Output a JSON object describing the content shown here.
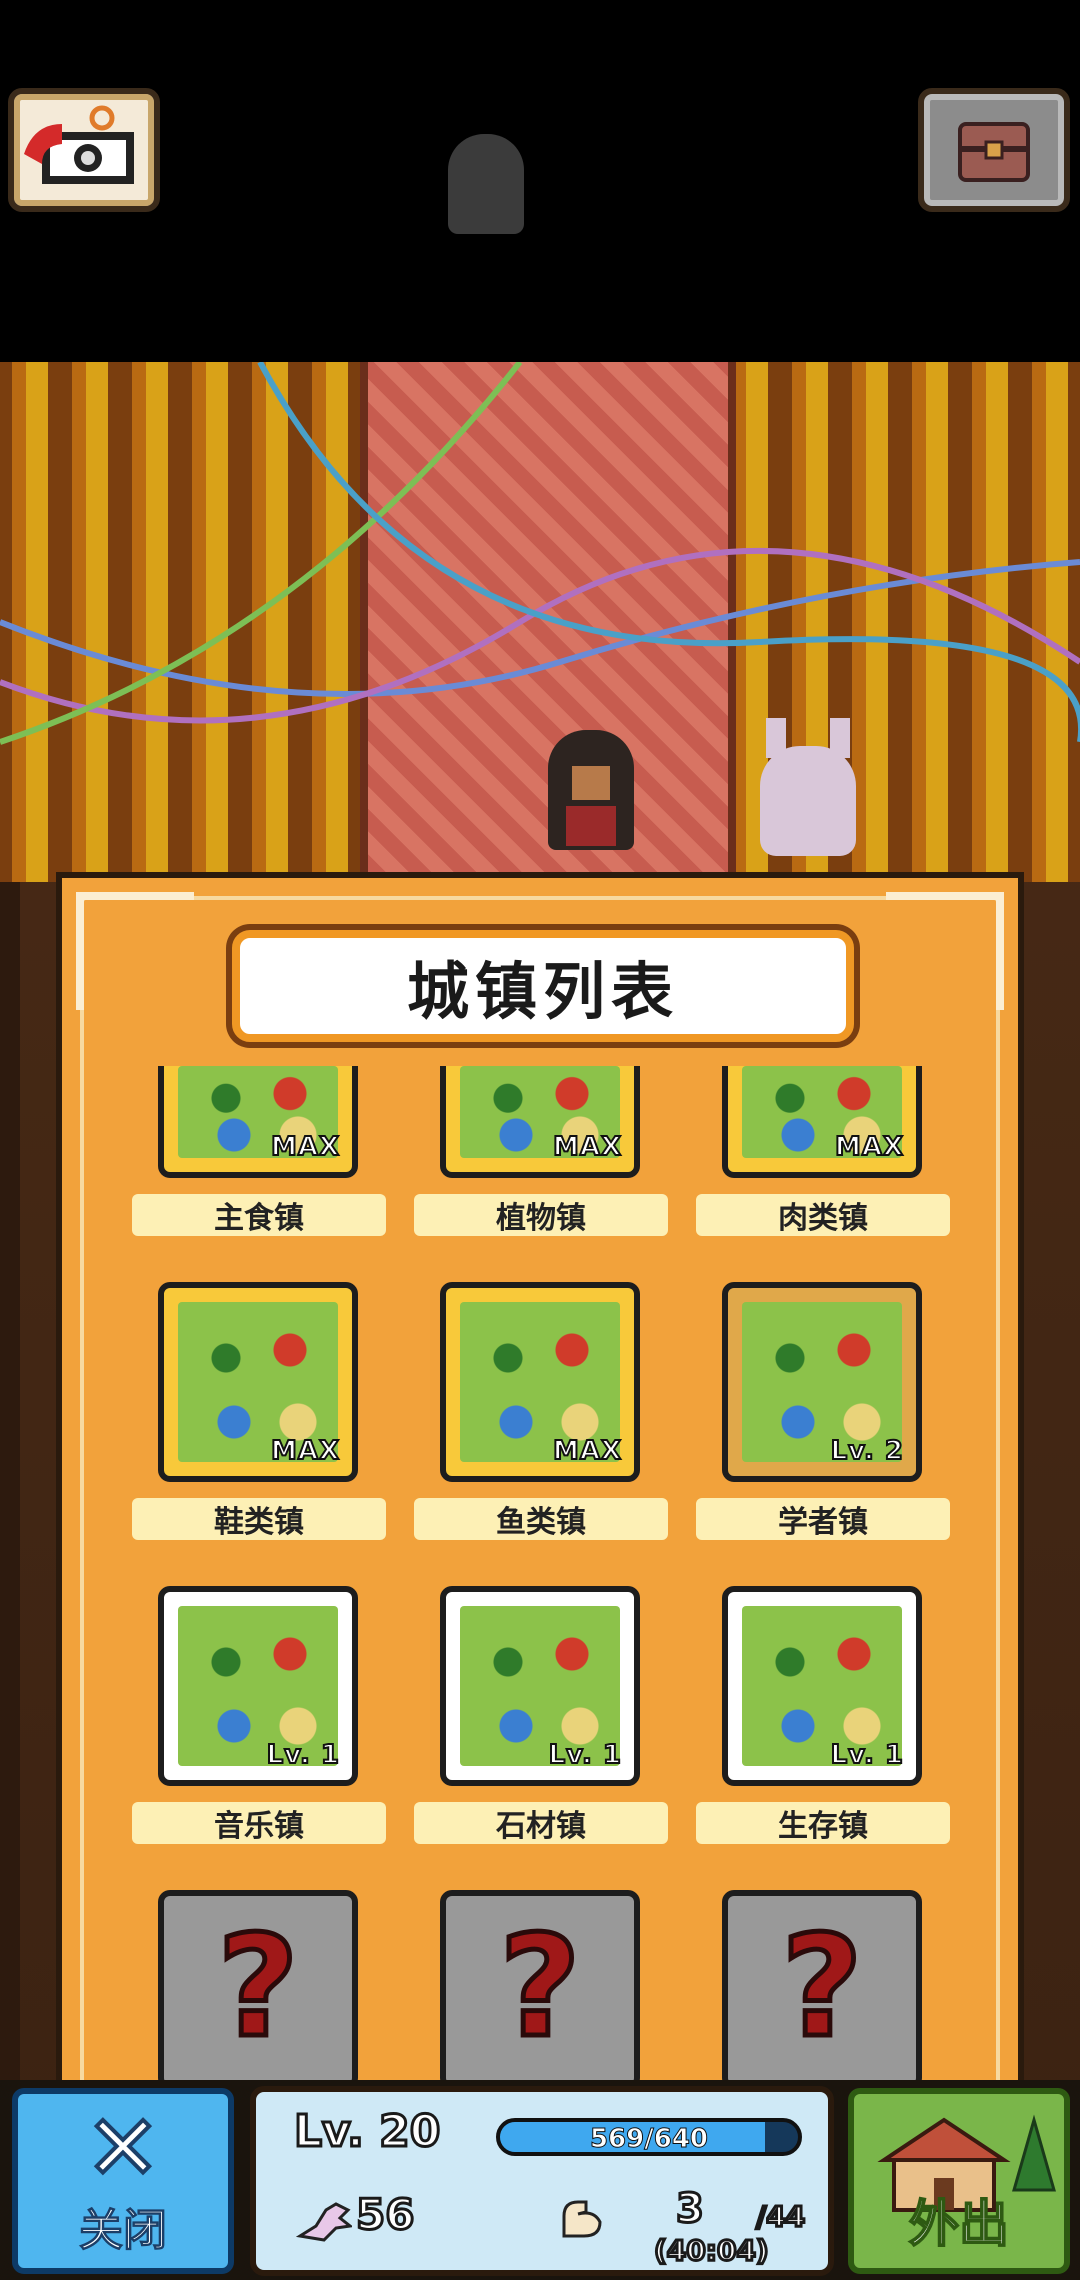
{
  "header": {
    "title": "城镇列表"
  },
  "towns": [
    {
      "name": "主食镇",
      "badge": "MAX"
    },
    {
      "name": "植物镇",
      "badge": "MAX"
    },
    {
      "name": "肉类镇",
      "badge": "MAX"
    },
    {
      "name": "鞋类镇",
      "badge": "MAX"
    },
    {
      "name": "鱼类镇",
      "badge": "MAX"
    },
    {
      "name": "学者镇",
      "badge": "Lv. 2"
    },
    {
      "name": "音乐镇",
      "badge": "Lv. 1"
    },
    {
      "name": "石材镇",
      "badge": "Lv. 1"
    },
    {
      "name": "生存镇",
      "badge": "Lv. 1"
    }
  ],
  "locked": [
    "?",
    "?",
    "?"
  ],
  "hud": {
    "close_label": "关闭",
    "close_symbol": "✕",
    "level": "Lv. 20",
    "xp": "569/640",
    "xp_progress": 0.889,
    "stamina": "56",
    "strength": "3",
    "strength_max": "/44",
    "timer": "(40:04)",
    "go_out_label": "外出"
  },
  "colors": {
    "panel": "#f2a23b",
    "label_bg": "#fdf0b5",
    "close_btn": "#4fb6ef",
    "go_out_btn": "#7ab64a",
    "lock_question": "#a01818"
  }
}
